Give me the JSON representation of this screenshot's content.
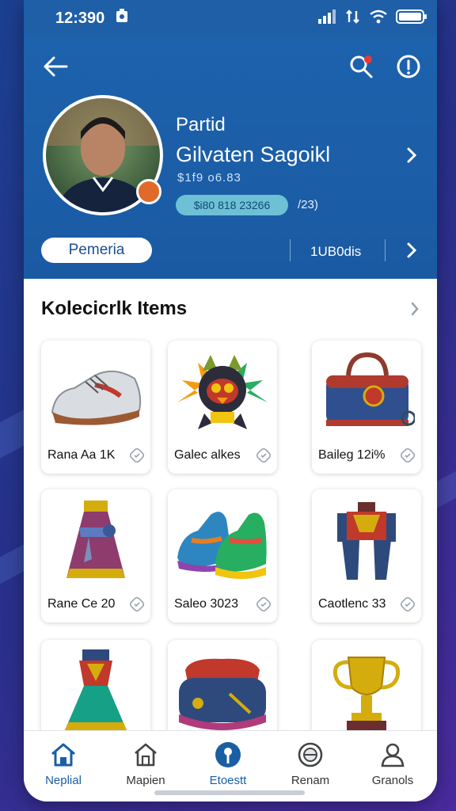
{
  "status_bar": {
    "time": "12:390"
  },
  "header": {
    "name_line1": "Partid",
    "name_line2": "Gilvaten Sagoikl",
    "subtitle": "$1f9 o6.83",
    "stat_pill": "$i80 818 23266",
    "stat_aside": "/23)",
    "action_button": "Pemeria",
    "action_value": "1UB0dis"
  },
  "section": {
    "title": "Kolecicrlk Items"
  },
  "items": [
    {
      "label": "Rana Aa 1K",
      "icon": "sneaker"
    },
    {
      "label": "Galec alkes",
      "icon": "mascot"
    },
    {
      "label": "Baileg 12i%",
      "icon": "bag"
    },
    {
      "label": "Rane Ce 20",
      "icon": "dress"
    },
    {
      "label": "Saleo 3023",
      "icon": "sneaker-colorful"
    },
    {
      "label": "Caotlenc 33",
      "icon": "costume"
    },
    {
      "label": "",
      "icon": "armor"
    },
    {
      "label": "",
      "icon": "case"
    },
    {
      "label": "",
      "icon": "trophy"
    }
  ],
  "nav": [
    {
      "label": "Neplial",
      "icon": "home-icon",
      "active": true
    },
    {
      "label": "Mapien",
      "icon": "store-icon",
      "active": false
    },
    {
      "label": "Etoestt",
      "icon": "pin-icon",
      "active": true
    },
    {
      "label": "Renam",
      "icon": "badge-icon",
      "active": false
    },
    {
      "label": "Granols",
      "icon": "profile-icon",
      "active": false
    }
  ],
  "colors": {
    "header_blue": "#1d62ad",
    "accent_blue": "#1a5fa5",
    "pill_teal": "#6ec0d4",
    "notification_red": "#e53935"
  }
}
